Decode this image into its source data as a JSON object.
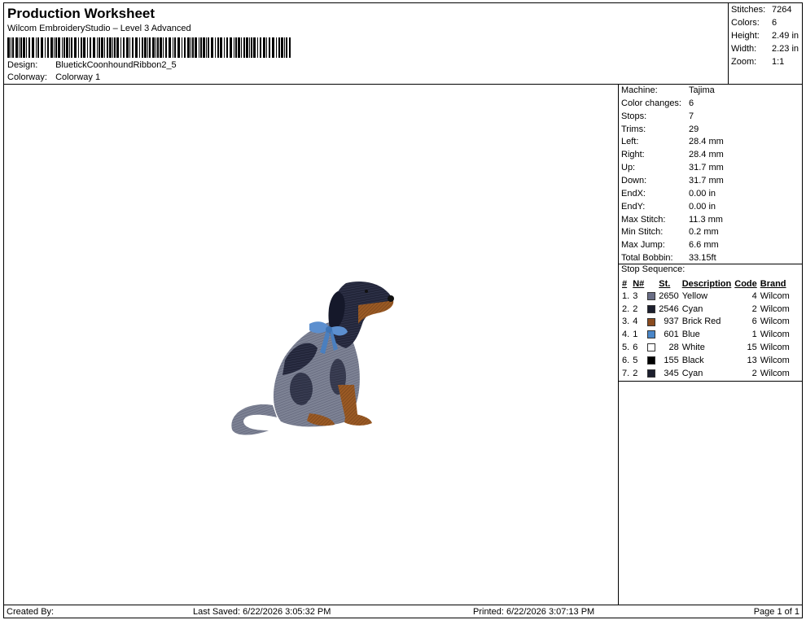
{
  "header": {
    "title": "Production Worksheet",
    "subtitle": "Wilcom EmbroideryStudio – Level 3 Advanced",
    "design_label": "Design:",
    "design_value": "BluetickCoonhoundRibbon2_5",
    "colorway_label": "Colorway:",
    "colorway_value": "Colorway 1"
  },
  "summary": [
    {
      "label": "Stitches:",
      "value": "7264"
    },
    {
      "label": "Colors:",
      "value": "6"
    },
    {
      "label": "Height:",
      "value": "2.49 in"
    },
    {
      "label": "Width:",
      "value": "2.23 in"
    },
    {
      "label": "Zoom:",
      "value": "1:1"
    }
  ],
  "properties": [
    {
      "label": "Machine:",
      "value": "Tajima"
    },
    {
      "label": "Color changes:",
      "value": "6"
    },
    {
      "label": "Stops:",
      "value": "7"
    },
    {
      "label": "Trims:",
      "value": "29"
    },
    {
      "label": "Left:",
      "value": "28.4 mm"
    },
    {
      "label": "Right:",
      "value": "28.4 mm"
    },
    {
      "label": "Up:",
      "value": "31.7 mm"
    },
    {
      "label": "Down:",
      "value": "31.7 mm"
    },
    {
      "label": "EndX:",
      "value": "0.00 in"
    },
    {
      "label": "EndY:",
      "value": "0.00 in"
    },
    {
      "label": "Max Stitch:",
      "value": "11.3 mm"
    },
    {
      "label": "Min Stitch:",
      "value": "0.2 mm"
    },
    {
      "label": "Max Jump:",
      "value": "6.6 mm"
    },
    {
      "label": "Total Bobbin:",
      "value": "33.15ft"
    }
  ],
  "stop_sequence": {
    "title": "Stop Sequence:",
    "columns": [
      "#",
      "N#",
      "St.",
      "Description",
      "Code",
      "Brand"
    ],
    "rows": [
      {
        "idx": "1.",
        "n": "3",
        "color": "#6a6e86",
        "st": "2650",
        "desc": "Yellow",
        "code": "4",
        "brand": "Wilcom"
      },
      {
        "idx": "2.",
        "n": "2",
        "color": "#1c1f2e",
        "st": "2546",
        "desc": "Cyan",
        "code": "2",
        "brand": "Wilcom"
      },
      {
        "idx": "3.",
        "n": "4",
        "color": "#8a4b1f",
        "st": "937",
        "desc": "Brick Red",
        "code": "6",
        "brand": "Wilcom"
      },
      {
        "idx": "4.",
        "n": "1",
        "color": "#4a86c8",
        "st": "601",
        "desc": "Blue",
        "code": "1",
        "brand": "Wilcom"
      },
      {
        "idx": "5.",
        "n": "6",
        "color": "#ffffff",
        "st": "28",
        "desc": "White",
        "code": "15",
        "brand": "Wilcom"
      },
      {
        "idx": "6.",
        "n": "5",
        "color": "#000000",
        "st": "155",
        "desc": "Black",
        "code": "13",
        "brand": "Wilcom"
      },
      {
        "idx": "7.",
        "n": "2",
        "color": "#1c1f2e",
        "st": "345",
        "desc": "Cyan",
        "code": "2",
        "brand": "Wilcom"
      }
    ]
  },
  "footer": {
    "created_by": "Created By:",
    "last_saved": "Last Saved: 6/22/2026 3:05:32 PM",
    "printed": "Printed: 6/22/2026 3:07:13 PM",
    "page": "Page 1 of 1"
  },
  "icons": {
    "barcode": "barcode-image",
    "design": "coonhound-embroidery-preview"
  }
}
